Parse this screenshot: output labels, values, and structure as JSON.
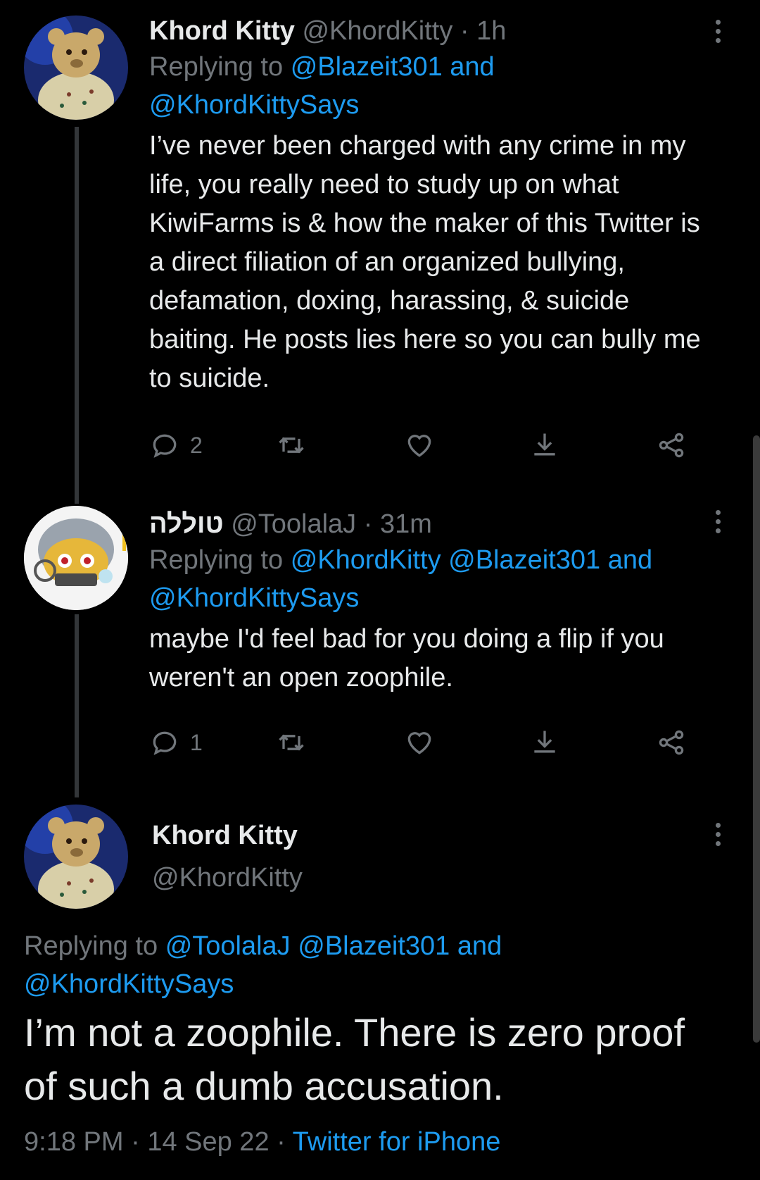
{
  "tweets": [
    {
      "name": "Khord Kitty",
      "handle": "@KhordKitty",
      "time": "1h",
      "replying_prefix": "Replying to",
      "replying_line1": "@Blazeit301 and",
      "replying_line2": "@KhordKittySays",
      "body": "I’ve never been charged with any crime in my life, you really need to study up on what KiwiFarms is & how the maker of this Twitter is a direct filiation of an organized bullying, defamation, doxing, harassing, & suicide baiting. He posts lies here so you can bully me to suicide.",
      "reply_count": "2",
      "avatar": "plush-bear-avatar"
    },
    {
      "name": "טוללה",
      "handle": "@ToolalaJ",
      "time": "31m",
      "replying_prefix": "Replying to",
      "replying_line1": "@KhordKitty @Blazeit301 and",
      "replying_line2": "@KhordKittySays",
      "body": "maybe I'd feel bad for you doing a flip if you weren't an open zoophile.",
      "reply_count": "1",
      "avatar": "robot-character-avatar"
    }
  ],
  "main_tweet": {
    "name": "Khord Kitty",
    "handle": "@KhordKitty",
    "replying_prefix": "Replying to",
    "replying_line1": "@ToolalaJ @Blazeit301 and",
    "replying_line2": "@KhordKittySays",
    "body": "I’m not a zoophile. There is zero proof of such a dumb accusation.",
    "time": "9:18 PM",
    "date": "14 Sep 22",
    "source": "Twitter for iPhone",
    "avatar": "plush-bear-avatar"
  },
  "separator": "·",
  "colors": {
    "background": "#000000",
    "text": "#e7e9ea",
    "muted": "#71767b",
    "link": "#1d9bf0"
  },
  "icons": [
    "reply-icon",
    "retweet-icon",
    "like-icon",
    "share-icon",
    "share-link-icon",
    "more-icon"
  ]
}
